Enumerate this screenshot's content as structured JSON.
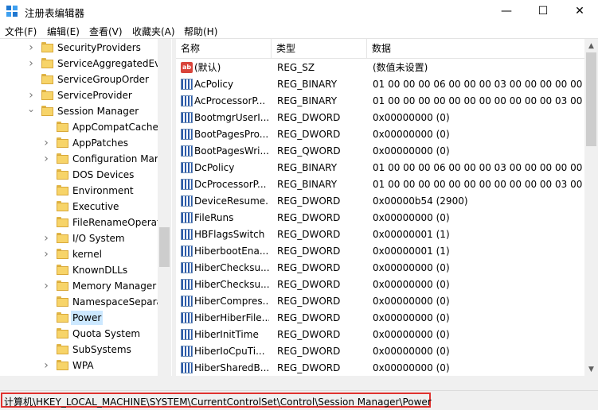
{
  "window": {
    "title": "注册表编辑器",
    "minimize_glyph": "—",
    "maximize_glyph": "☐",
    "close_glyph": "✕"
  },
  "menu": [
    {
      "label": "文件(F)"
    },
    {
      "label": "编辑(E)"
    },
    {
      "label": "查看(V)"
    },
    {
      "label": "收藏夹(A)"
    },
    {
      "label": "帮助(H)"
    }
  ],
  "tree": {
    "items": [
      {
        "label": "SecurityProviders",
        "expandable": true,
        "level": 1
      },
      {
        "label": "ServiceAggregatedEv",
        "expandable": true,
        "level": 1
      },
      {
        "label": "ServiceGroupOrder",
        "expandable": false,
        "level": 1
      },
      {
        "label": "ServiceProvider",
        "expandable": true,
        "level": 1
      },
      {
        "label": "Session Manager",
        "expandable": true,
        "expanded": true,
        "level": 1
      },
      {
        "label": "AppCompatCache",
        "expandable": false,
        "level": 2
      },
      {
        "label": "AppPatches",
        "expandable": true,
        "level": 2
      },
      {
        "label": "Configuration Mar",
        "expandable": true,
        "level": 2
      },
      {
        "label": "DOS Devices",
        "expandable": false,
        "level": 2
      },
      {
        "label": "Environment",
        "expandable": false,
        "level": 2
      },
      {
        "label": "Executive",
        "expandable": false,
        "level": 2
      },
      {
        "label": "FileRenameOperat",
        "expandable": false,
        "level": 2
      },
      {
        "label": "I/O System",
        "expandable": true,
        "level": 2
      },
      {
        "label": "kernel",
        "expandable": true,
        "level": 2
      },
      {
        "label": "KnownDLLs",
        "expandable": false,
        "level": 2
      },
      {
        "label": "Memory Manager",
        "expandable": true,
        "level": 2
      },
      {
        "label": "NamespaceSepara",
        "expandable": false,
        "level": 2
      },
      {
        "label": "Power",
        "expandable": false,
        "level": 2,
        "selected": true
      },
      {
        "label": "Quota System",
        "expandable": false,
        "level": 2
      },
      {
        "label": "SubSystems",
        "expandable": false,
        "level": 2
      },
      {
        "label": "WPA",
        "expandable": true,
        "level": 2
      }
    ]
  },
  "list": {
    "columns": {
      "name": "名称",
      "type": "类型",
      "data": "数据"
    },
    "rows": [
      {
        "icon": "string-value-icon",
        "name": "(默认)",
        "type": "REG_SZ",
        "data": "(数值未设置)"
      },
      {
        "icon": "binary-value-icon",
        "name": "AcPolicy",
        "type": "REG_BINARY",
        "data": "01 00 00 00 06 00 00 00 03 00 00 00 00 00 0"
      },
      {
        "icon": "binary-value-icon",
        "name": "AcProcessorP...",
        "type": "REG_BINARY",
        "data": "01 00 00 00 00 00 00 00 00 00 00 00 03 00 0"
      },
      {
        "icon": "binary-value-icon",
        "name": "BootmgrUserI...",
        "type": "REG_DWORD",
        "data": "0x00000000 (0)"
      },
      {
        "icon": "binary-value-icon",
        "name": "BootPagesPro...",
        "type": "REG_DWORD",
        "data": "0x00000000 (0)"
      },
      {
        "icon": "binary-value-icon",
        "name": "BootPagesWri...",
        "type": "REG_QWORD",
        "data": "0x00000000 (0)"
      },
      {
        "icon": "binary-value-icon",
        "name": "DcPolicy",
        "type": "REG_BINARY",
        "data": "01 00 00 00 06 00 00 00 03 00 00 00 00 00 0"
      },
      {
        "icon": "binary-value-icon",
        "name": "DcProcessorP...",
        "type": "REG_BINARY",
        "data": "01 00 00 00 00 00 00 00 00 00 00 00 03 00 0"
      },
      {
        "icon": "binary-value-icon",
        "name": "DeviceResume...",
        "type": "REG_DWORD",
        "data": "0x00000b54 (2900)"
      },
      {
        "icon": "binary-value-icon",
        "name": "FileRuns",
        "type": "REG_DWORD",
        "data": "0x00000000 (0)"
      },
      {
        "icon": "binary-value-icon",
        "name": "HBFlagsSwitch",
        "type": "REG_DWORD",
        "data": "0x00000001 (1)"
      },
      {
        "icon": "binary-value-icon",
        "name": "HiberbootEna...",
        "type": "REG_DWORD",
        "data": "0x00000001 (1)"
      },
      {
        "icon": "binary-value-icon",
        "name": "HiberChecksu...",
        "type": "REG_DWORD",
        "data": "0x00000000 (0)"
      },
      {
        "icon": "binary-value-icon",
        "name": "HiberChecksu...",
        "type": "REG_DWORD",
        "data": "0x00000000 (0)"
      },
      {
        "icon": "binary-value-icon",
        "name": "HiberCompres...",
        "type": "REG_DWORD",
        "data": "0x00000000 (0)"
      },
      {
        "icon": "binary-value-icon",
        "name": "HiberHiberFile...",
        "type": "REG_DWORD",
        "data": "0x00000000 (0)"
      },
      {
        "icon": "binary-value-icon",
        "name": "HiberInitTime",
        "type": "REG_DWORD",
        "data": "0x00000000 (0)"
      },
      {
        "icon": "binary-value-icon",
        "name": "HiberIoCpuTi...",
        "type": "REG_DWORD",
        "data": "0x00000000 (0)"
      },
      {
        "icon": "binary-value-icon",
        "name": "HiberSharedB...",
        "type": "REG_DWORD",
        "data": "0x00000000 (0)"
      }
    ]
  },
  "status": {
    "path": "计算机\\HKEY_LOCAL_MACHINE\\SYSTEM\\CurrentControlSet\\Control\\Session Manager\\Power"
  },
  "colors": {
    "selection": "#cce8ff",
    "status_highlight": "#e0322f",
    "folder": "#f7d469"
  }
}
